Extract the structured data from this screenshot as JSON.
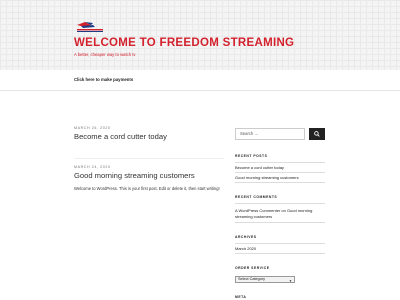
{
  "site": {
    "title": "WELCOME TO FREEDOM STREAMING",
    "tagline": "A better, cheaper way to watch tv",
    "colors": {
      "brand": "#d3212d",
      "header_bg": "#f4f4f4"
    }
  },
  "nav": {
    "payment_link": "Click here to make payments"
  },
  "posts": [
    {
      "date": "MARCH 26, 2020",
      "title": "Become a cord cutter today"
    },
    {
      "date": "MARCH 24, 2020",
      "title": "Good morning streaming customers",
      "excerpt": "Welcome to WordPress. This is your first post. Edit or delete it, then start writing!"
    }
  ],
  "sidebar": {
    "search": {
      "placeholder": "Search …",
      "icon": "search-icon"
    },
    "recent_posts": {
      "title": "RECENT POSTS",
      "items": [
        "Become a cord cutter today",
        "Good morning streaming customers"
      ]
    },
    "recent_comments": {
      "title": "RECENT COMMENTS",
      "items": [
        "A WordPress Commenter on Good morning streaming customers"
      ]
    },
    "archives": {
      "title": "ARCHIVES",
      "items": [
        "March 2020"
      ]
    },
    "order_service": {
      "title": "ORDER SERVICE",
      "selected": "Select Category"
    },
    "meta": {
      "title": "META"
    }
  }
}
